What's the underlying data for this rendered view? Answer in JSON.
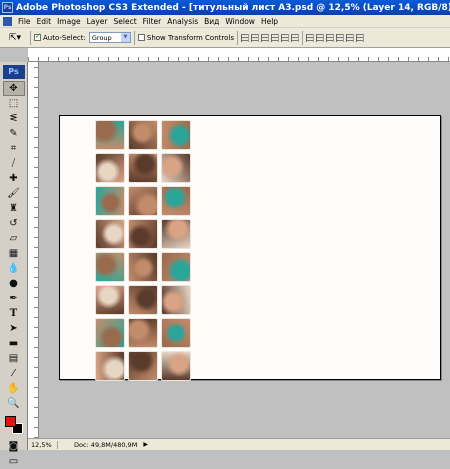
{
  "titlebar": {
    "title": "Adobe Photoshop CS3 Extended - [титульный лист А3.psd @ 12,5% (Layer 14, RGB/8)]",
    "app_icon": "ps-icon"
  },
  "menubar": {
    "items": [
      "File",
      "Edit",
      "Image",
      "Layer",
      "Select",
      "Filter",
      "Analysis",
      "Вид",
      "Window",
      "Help"
    ]
  },
  "options": {
    "auto_select_label": "Auto-Select:",
    "auto_select_checked": true,
    "group_value": "Group",
    "show_transform_label": "Show Transform Controls",
    "show_transform_checked": false
  },
  "toolbox": {
    "logo": "Ps",
    "tools": [
      "move-tool",
      "marquee-tool",
      "lasso-tool",
      "quick-select-tool",
      "crop-tool",
      "slice-tool",
      "healing-tool",
      "brush-tool",
      "clone-stamp-tool",
      "history-brush-tool",
      "eraser-tool",
      "gradient-tool",
      "blur-tool",
      "dodge-tool",
      "pen-tool",
      "type-tool",
      "path-select-tool",
      "shape-tool",
      "notes-tool",
      "eyedropper-tool",
      "hand-tool",
      "zoom-tool"
    ],
    "foreground_color": "#e81010",
    "background_color": "#000000"
  },
  "document": {
    "tile_rows": 8,
    "tile_columns": 3,
    "tile_palette": [
      "#9a6a4e",
      "#c28c6a",
      "#2aa59a",
      "#e8d6c4",
      "#5a3a2a",
      "#d9a486"
    ]
  },
  "statusbar": {
    "zoom": "12,5%",
    "doc_info": "Doc: 49,8M/480,9M"
  }
}
